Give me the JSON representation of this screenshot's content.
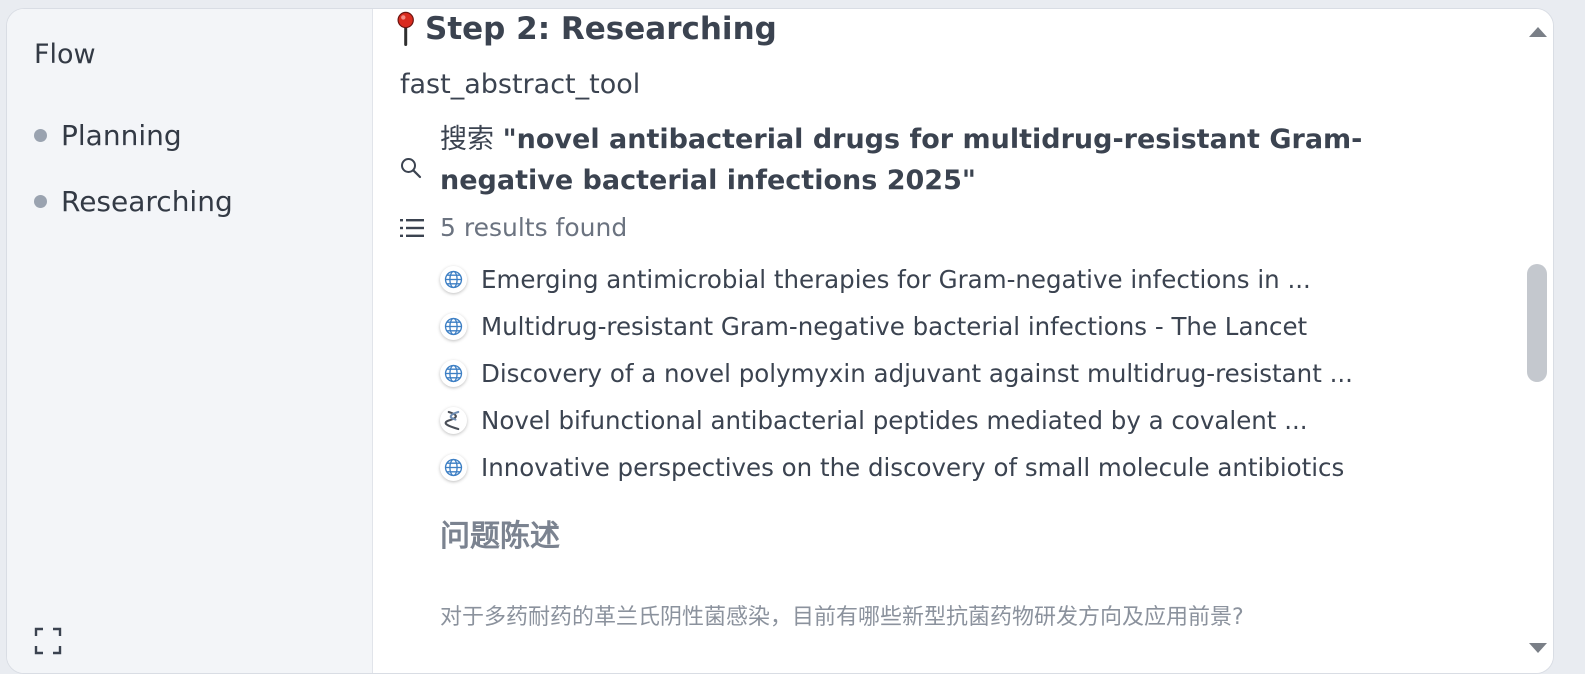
{
  "sidebar": {
    "title": "Flow",
    "items": [
      {
        "label": "Planning"
      },
      {
        "label": "Researching"
      }
    ],
    "expand_icon": "expand-icon"
  },
  "step": {
    "icon": "pushpin-icon",
    "title": "Step 2: Researching"
  },
  "tool": {
    "name": "fast_abstract_tool"
  },
  "search": {
    "prefix": "搜索",
    "query": "\"novel antibacterial drugs for multidrug-resistant Gram-negative bacterial infections 2025\""
  },
  "results": {
    "summary": "5 results found",
    "items": [
      {
        "icon": "globe-icon",
        "title": "Emerging antimicrobial therapies for Gram-negative infections in ..."
      },
      {
        "icon": "globe-icon",
        "title": "Multidrug-resistant Gram-negative bacterial infections - The Lancet"
      },
      {
        "icon": "globe-icon",
        "title": "Discovery of a novel polymyxin adjuvant against multidrug-resistant ..."
      },
      {
        "icon": "helix-icon",
        "title": "Novel bifunctional antibacterial peptides mediated by a covalent ..."
      },
      {
        "icon": "globe-icon",
        "title": "Innovative perspectives on the discovery of small molecule antibiotics"
      }
    ]
  },
  "section": {
    "heading": "问题陈述",
    "text": "对于多药耐药的革兰氏阴性菌感染，目前有哪些新型抗菌药物研发方向及应用前景?"
  },
  "colors": {
    "sidebar_bg": "#f3f5f8",
    "text": "#3b4350",
    "muted": "#7b8390",
    "pin_red": "#d92b1f",
    "globe_blue": "#3d7fc4"
  }
}
